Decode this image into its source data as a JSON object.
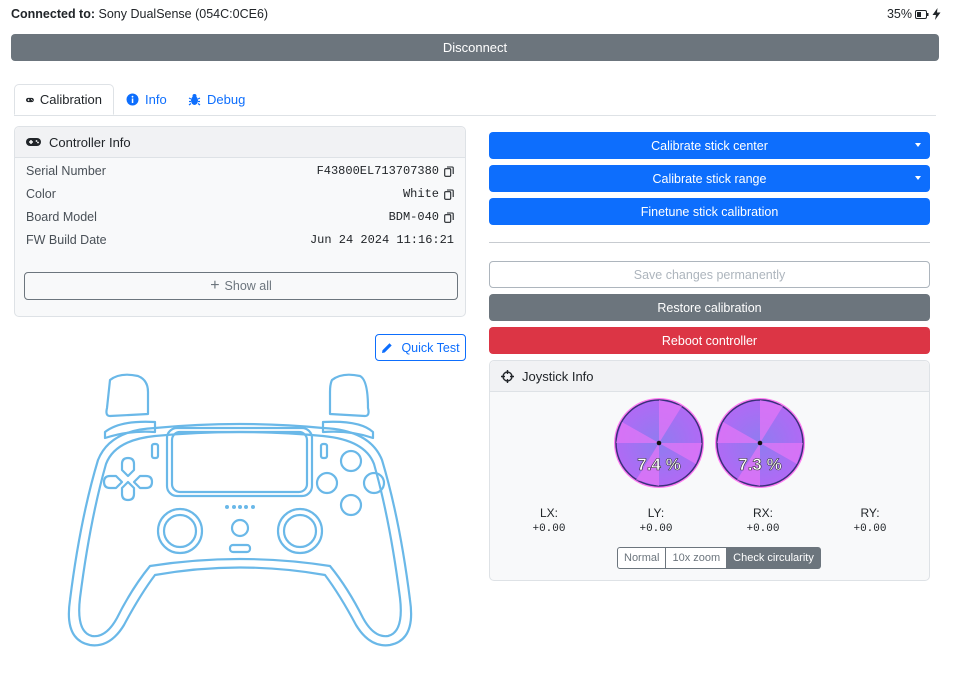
{
  "status": {
    "connected_label": "Connected to:",
    "device": "Sony DualSense (054C:0CE6)",
    "battery": "35%"
  },
  "disconnect_label": "Disconnect",
  "tabs": [
    {
      "label": "Calibration",
      "icon": "gamepad-icon",
      "active": true
    },
    {
      "label": "Info",
      "icon": "info-icon",
      "active": false
    },
    {
      "label": "Debug",
      "icon": "bug-icon",
      "active": false
    }
  ],
  "controller_info": {
    "title": "Controller Info",
    "rows": [
      {
        "label": "Serial Number",
        "value": "F43800EL713707380",
        "copy": true
      },
      {
        "label": "Color",
        "value": "White",
        "copy": true
      },
      {
        "label": "Board Model",
        "value": "BDM-040",
        "copy": true
      },
      {
        "label": "FW Build Date",
        "value": "Jun 24 2024 11:16:21",
        "copy": false
      }
    ],
    "show_all_label": "Show all"
  },
  "quick_test_label": "Quick Test",
  "actions": {
    "calibrate_center": "Calibrate stick center",
    "calibrate_range": "Calibrate stick range",
    "finetune": "Finetune stick calibration",
    "save": "Save changes permanently",
    "restore": "Restore calibration",
    "reboot": "Reboot controller"
  },
  "joystick_info": {
    "title": "Joystick Info",
    "left_circularity": "7.4 %",
    "right_circularity": "7.3 %",
    "axes": [
      {
        "label": "LX:",
        "value": "+0.00"
      },
      {
        "label": "LY:",
        "value": "+0.00"
      },
      {
        "label": "RX:",
        "value": "+0.00"
      },
      {
        "label": "RY:",
        "value": "+0.00"
      }
    ],
    "modes": [
      "Normal",
      "10x zoom",
      "Check circularity"
    ],
    "selected_mode": "Check circularity"
  },
  "colors": {
    "primary": "#0d6efd",
    "secondary": "#6c757d",
    "danger": "#dc3545",
    "controller_outline": "#6ab8e8"
  }
}
